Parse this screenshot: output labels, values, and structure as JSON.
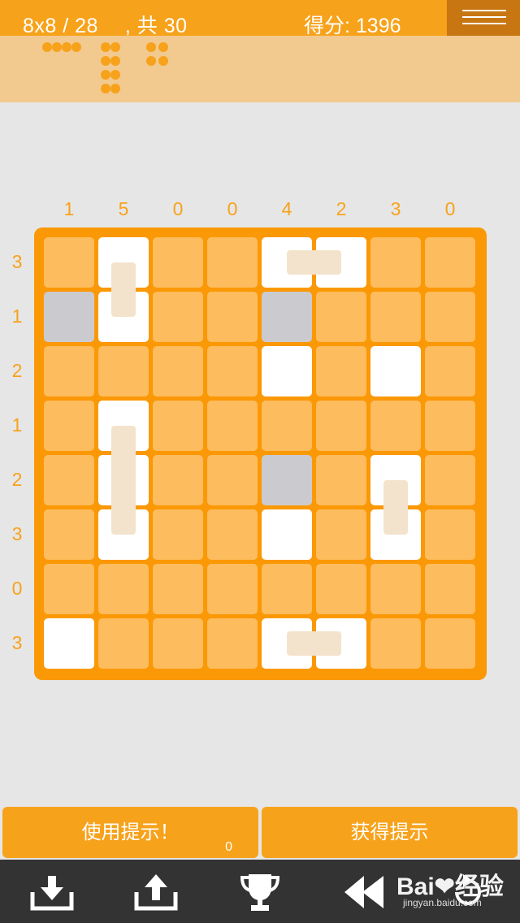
{
  "header": {
    "level_text": "8x8 / 28 　, 共 30",
    "score_text": "得分: 1396"
  },
  "board": {
    "size": 8,
    "col_hints": [
      "1",
      "5",
      "0",
      "0",
      "4",
      "2",
      "3",
      "0"
    ],
    "row_hints": [
      "3",
      "1",
      "2",
      "1",
      "2",
      "3",
      "0",
      "3"
    ],
    "cells": [
      [
        "empty",
        "ship-dot",
        "empty",
        "empty",
        "ship-dot",
        "ship-dot",
        "empty",
        "empty"
      ],
      [
        "water",
        "ship-dot",
        "empty",
        "empty",
        "water",
        "empty",
        "empty",
        "empty"
      ],
      [
        "empty",
        "empty",
        "empty",
        "empty",
        "ship-dot",
        "empty",
        "ship-dot",
        "empty"
      ],
      [
        "empty",
        "ship-dot",
        "empty",
        "empty",
        "empty",
        "empty",
        "empty",
        "empty"
      ],
      [
        "empty",
        "ship-grey",
        "empty",
        "empty",
        "water",
        "empty",
        "ship-dot",
        "empty"
      ],
      [
        "empty",
        "ship-dot",
        "empty",
        "empty",
        "ship-dot",
        "empty",
        "ship-dot",
        "empty"
      ],
      [
        "empty",
        "empty",
        "empty",
        "empty",
        "empty",
        "empty",
        "empty",
        "empty"
      ],
      [
        "ship-dot",
        "empty",
        "empty",
        "empty",
        "ship-dot",
        "ship-grey",
        "empty",
        "empty"
      ]
    ],
    "links": [
      {
        "r1": 0,
        "c1": 4,
        "r2": 0,
        "c2": 5
      },
      {
        "r1": 0,
        "c1": 1,
        "r2": 1,
        "c2": 1
      },
      {
        "r1": 3,
        "c1": 1,
        "r2": 5,
        "c2": 1
      },
      {
        "r1": 4,
        "c1": 6,
        "r2": 5,
        "c2": 6
      },
      {
        "r1": 7,
        "c1": 4,
        "r2": 7,
        "c2": 5
      }
    ]
  },
  "actions": {
    "use_hint_label": "使用提示！",
    "hint_count": "0",
    "get_hint_label": "获得提示"
  },
  "toolbar": {
    "icons": [
      "download-icon",
      "upload-icon",
      "trophy-icon",
      "rewind-icon",
      "restart-icon"
    ]
  },
  "watermark": {
    "logo_text": "Bai❤经验",
    "url_text": "jingyan.baidu.com"
  },
  "colors": {
    "accent": "#f7a21b",
    "board_frame": "#fb9806",
    "empty_cell": "#fdbc5d",
    "water_cell": "#cbcbcf",
    "ship_cell": "#ffffff",
    "toolbox_bg": "#f2c98e",
    "bottom_bar": "#333333"
  }
}
